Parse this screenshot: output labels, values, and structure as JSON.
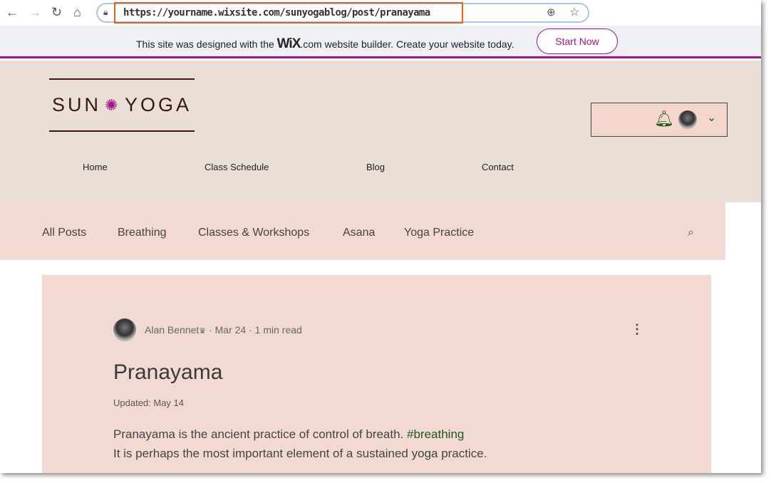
{
  "browser": {
    "url": "https://yourname.wixsite.com/sunyogablog/post/pranayama"
  },
  "wix_banner": {
    "text_before": "This site was designed with the",
    "brand": "WiX",
    "text_after": ".com website builder. Create your website today.",
    "button": "Start Now",
    "accent": "#a0158a"
  },
  "site": {
    "logo_left": "SUN",
    "logo_right": "YOGA",
    "nav": [
      "Home",
      "Class Schedule",
      "Blog",
      "Contact"
    ]
  },
  "categories": [
    "All Posts",
    "Breathing",
    "Classes & Workshops",
    "Asana",
    "Yoga Practice"
  ],
  "post": {
    "author": "Alan Bennet",
    "date": "Mar 24",
    "read_time": "1 min read",
    "title": "Pranayama",
    "updated": "Updated: May 14",
    "body_line1": "Pranayama is the ancient practice of control of breath.",
    "hashtag": "#breathing",
    "body_line2": "It is perhaps the most important element of a sustained yoga practice."
  },
  "colors": {
    "header_bg": "#e9dfd6",
    "nav_bg": "#f2d9d2",
    "hashtag": "#1e5a20",
    "bell": "#1b5e20"
  }
}
